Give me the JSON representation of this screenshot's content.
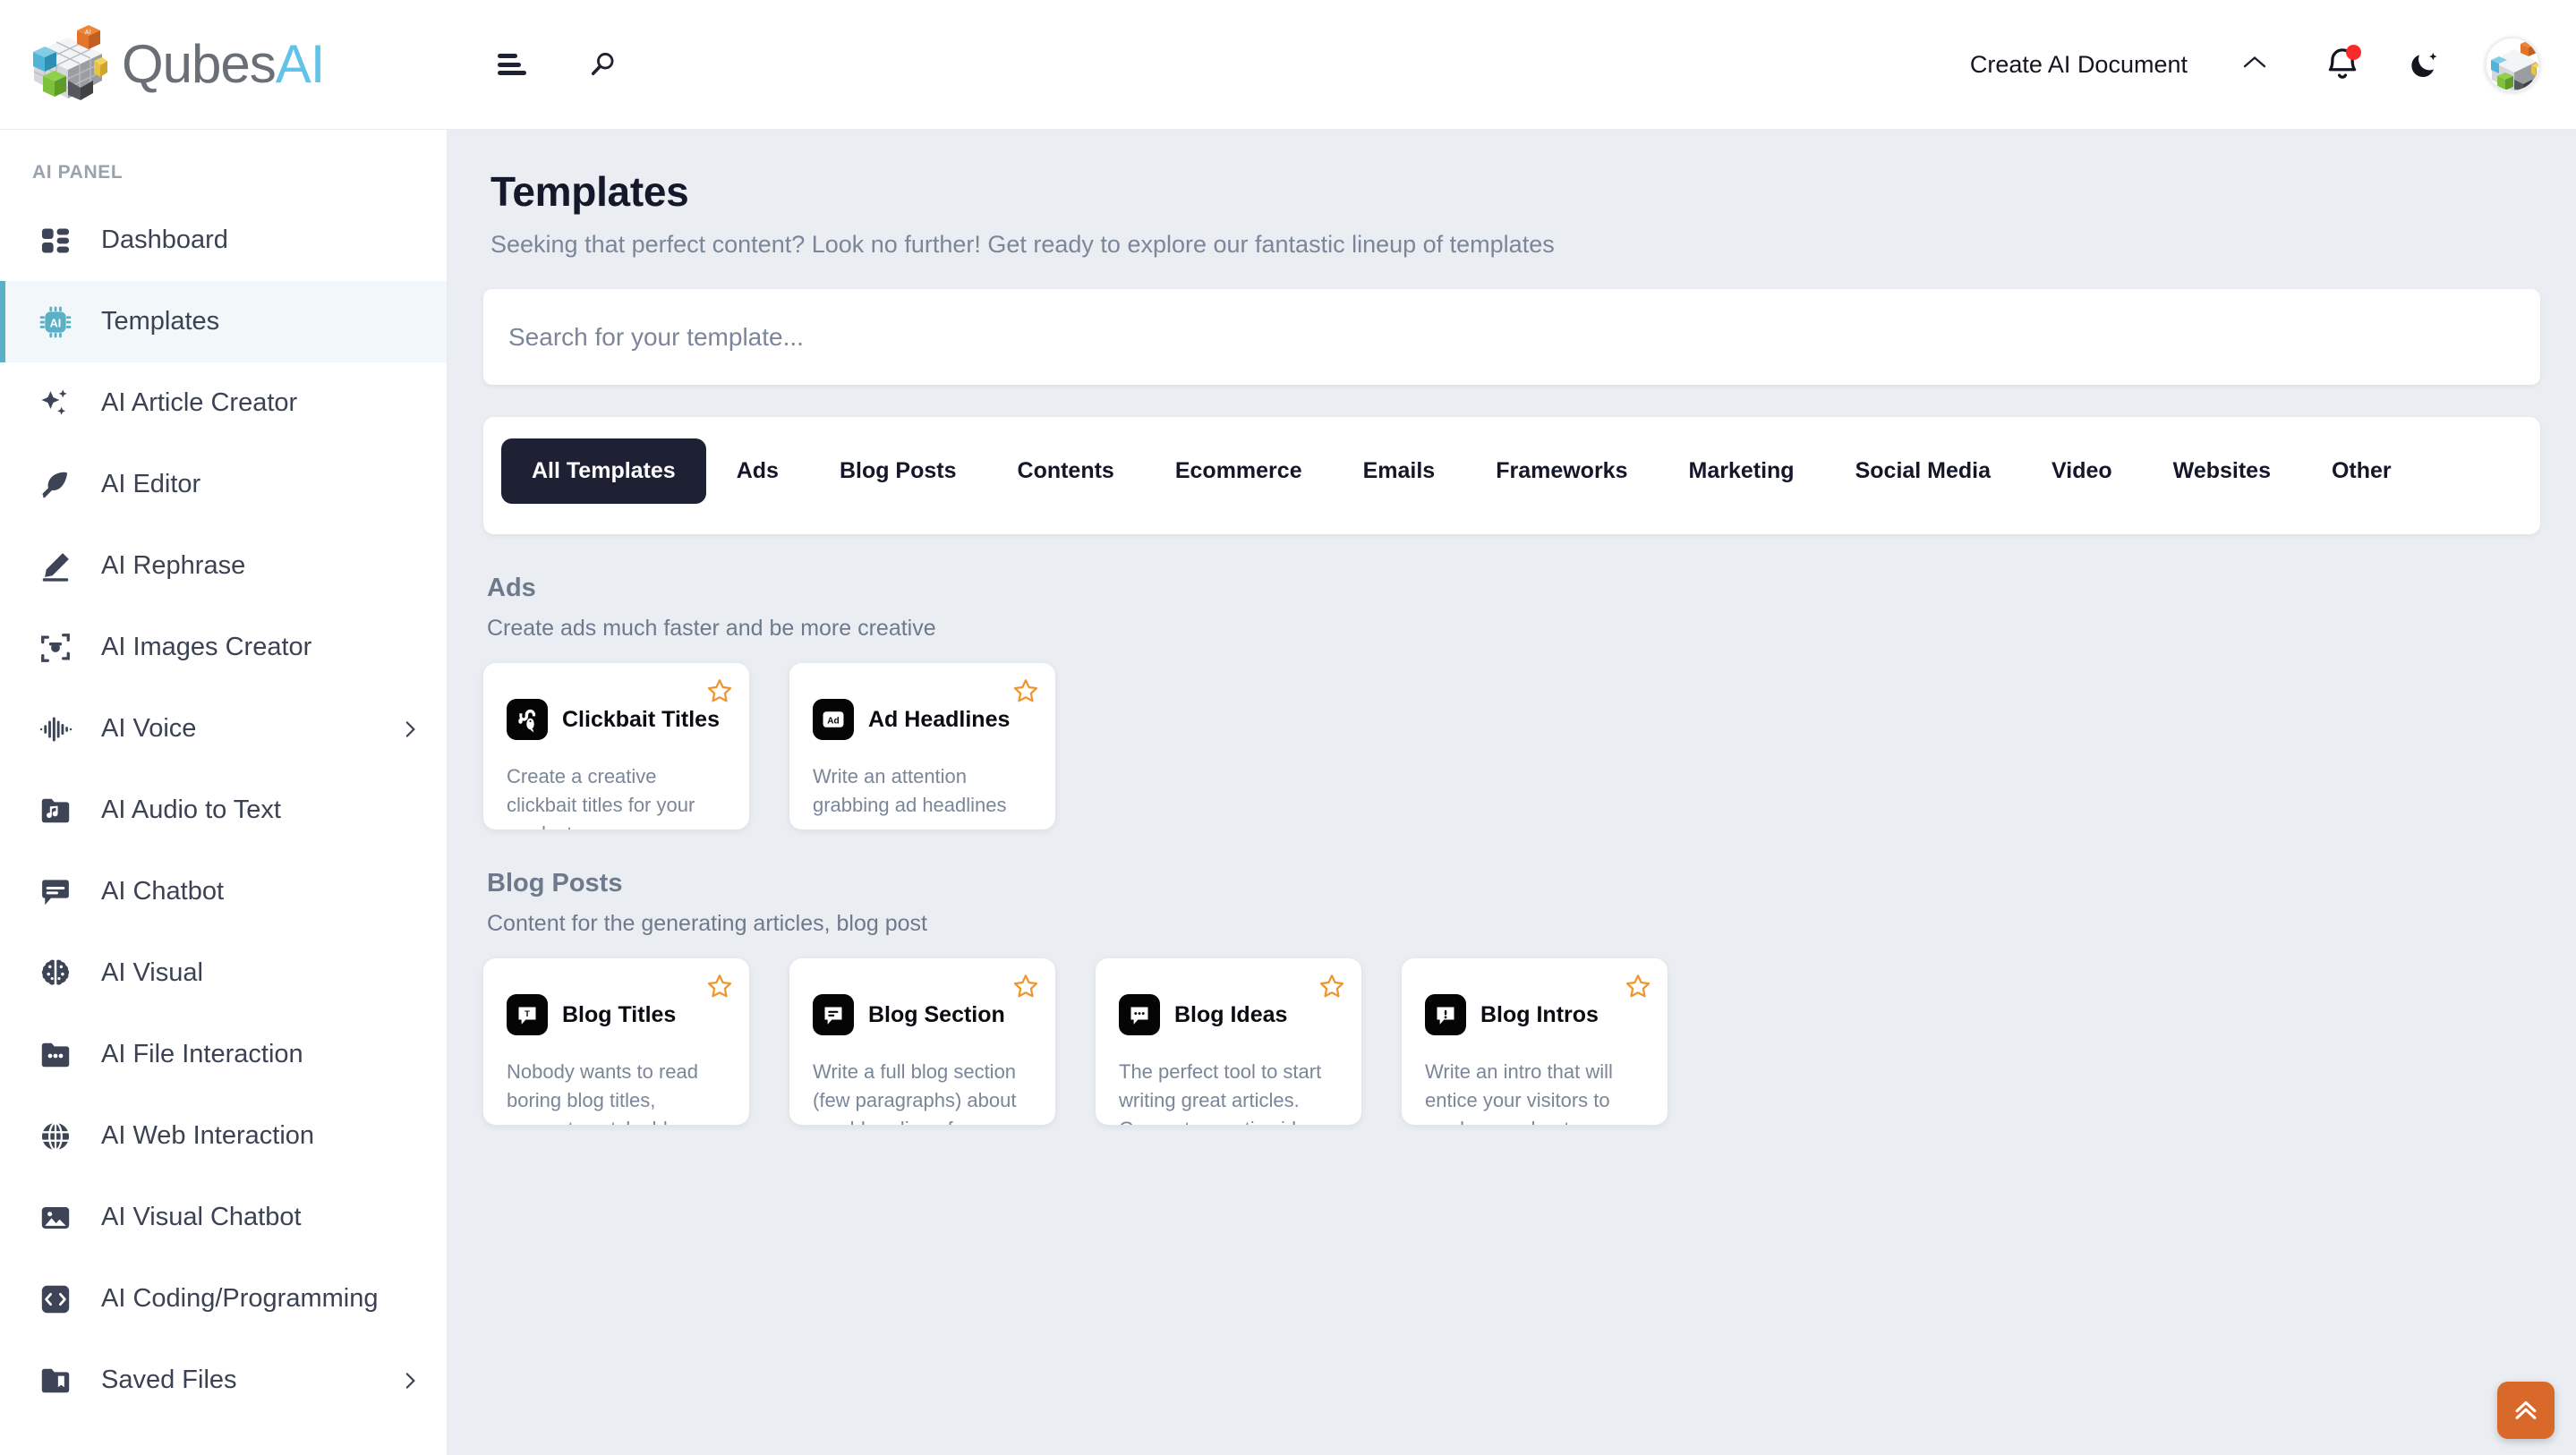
{
  "brand": {
    "name_part1": "Qubes",
    "name_part2": "AI"
  },
  "header": {
    "create_document_label": "Create AI Document",
    "icons": {
      "menu": "hamburger-icon",
      "search": "search-icon",
      "collapse": "chevron-up-icon",
      "notifications": "bell-icon",
      "theme": "moon-icon",
      "avatar": "user-avatar"
    }
  },
  "sidebar": {
    "panel_label": "AI PANEL",
    "items": [
      {
        "label": "Dashboard",
        "icon": "grid-icon",
        "active": false,
        "chevron": false
      },
      {
        "label": "Templates",
        "icon": "ai-chip-icon",
        "active": true,
        "chevron": false
      },
      {
        "label": "AI Article Creator",
        "icon": "sparkles-icon",
        "active": false,
        "chevron": false
      },
      {
        "label": "AI Editor",
        "icon": "feather-icon",
        "active": false,
        "chevron": false
      },
      {
        "label": "AI Rephrase",
        "icon": "pencil-icon",
        "active": false,
        "chevron": false
      },
      {
        "label": "AI Images Creator",
        "icon": "camera-frame-icon",
        "active": false,
        "chevron": false
      },
      {
        "label": "AI Voice",
        "icon": "waveform-icon",
        "active": false,
        "chevron": true
      },
      {
        "label": "AI Audio to Text",
        "icon": "folder-music-icon",
        "active": false,
        "chevron": false
      },
      {
        "label": "AI Chatbot",
        "icon": "chat-bubble-icon",
        "active": false,
        "chevron": false
      },
      {
        "label": "AI Visual",
        "icon": "brain-icon",
        "active": false,
        "chevron": false
      },
      {
        "label": "AI File Interaction",
        "icon": "folder-dots-icon",
        "active": false,
        "chevron": false
      },
      {
        "label": "AI Web Interaction",
        "icon": "globe-icon",
        "active": false,
        "chevron": false
      },
      {
        "label": "AI Visual Chatbot",
        "icon": "image-icon",
        "active": false,
        "chevron": false
      },
      {
        "label": "AI Coding/Programming",
        "icon": "code-icon",
        "active": false,
        "chevron": false
      },
      {
        "label": "Saved Files",
        "icon": "folder-bookmark-icon",
        "active": false,
        "chevron": true
      }
    ]
  },
  "main": {
    "title": "Templates",
    "subtitle": "Seeking that perfect content? Look no further! Get ready to explore our fantastic lineup of templates",
    "search_placeholder": "Search for your template...",
    "search_value": "",
    "tabs": [
      {
        "label": "All Templates",
        "active": true
      },
      {
        "label": "Ads",
        "active": false
      },
      {
        "label": "Blog Posts",
        "active": false
      },
      {
        "label": "Contents",
        "active": false
      },
      {
        "label": "Ecommerce",
        "active": false
      },
      {
        "label": "Emails",
        "active": false
      },
      {
        "label": "Frameworks",
        "active": false
      },
      {
        "label": "Marketing",
        "active": false
      },
      {
        "label": "Social Media",
        "active": false
      },
      {
        "label": "Video",
        "active": false
      },
      {
        "label": "Websites",
        "active": false
      },
      {
        "label": "Other",
        "active": false
      }
    ],
    "sections": [
      {
        "title": "Ads",
        "subtitle": "Create ads much faster and be more creative",
        "cards": [
          {
            "title": "Clickbait Titles",
            "desc": "Create a creative clickbait titles for your products",
            "icon": "fish-hook-icon",
            "starred": false
          },
          {
            "title": "Ad Headlines",
            "desc": "Write an attention grabbing ad headlines",
            "icon": "ad-badge-icon",
            "starred": false
          }
        ]
      },
      {
        "title": "Blog Posts",
        "subtitle": "Content for the generating articles, blog post",
        "cards": [
          {
            "title": "Blog Titles",
            "desc": "Nobody wants to read boring blog titles, generate catchy blog titles with this tool",
            "icon": "bubble-t-icon",
            "starred": false
          },
          {
            "title": "Blog Section",
            "desc": "Write a full blog section (few paragraphs) about a subheading of your article",
            "icon": "bubble-lines-icon",
            "starred": false
          },
          {
            "title": "Blog Ideas",
            "desc": "The perfect tool to start writing great articles. Generate creative ideas for your next post",
            "icon": "bubble-dots-icon",
            "starred": false
          },
          {
            "title": "Blog Intros",
            "desc": "Write an intro that will entice your visitors to read more about your article",
            "icon": "bubble-bang-icon",
            "starred": false
          }
        ]
      }
    ],
    "scroll_top_icon": "double-chevron-up-icon"
  },
  "colors": {
    "background": "#eaeef2",
    "accent_teal": "#5cb0c6",
    "accent_orange": "#d9692a",
    "star_orange": "#f0952f",
    "dark": "#1e2033",
    "brand_blue": "#62c3e8",
    "notification_red": "#fb2a2a"
  }
}
